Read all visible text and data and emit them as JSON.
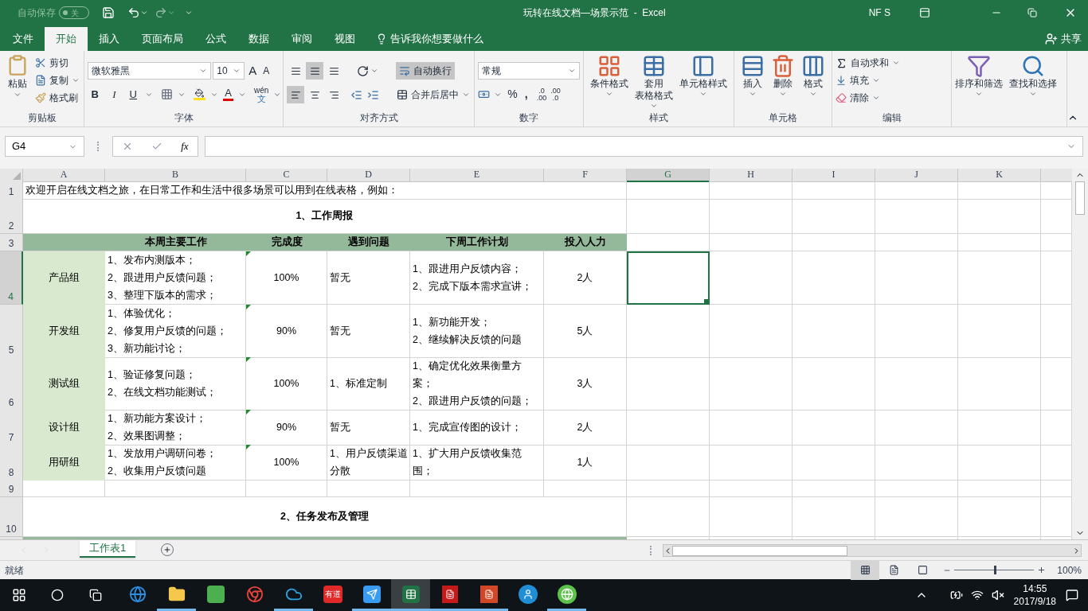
{
  "title_bar": {
    "autosave": {
      "label": "自动保存",
      "on": false,
      "state_label": "关"
    },
    "title": "玩转在线文档—场景示范  -  Excel",
    "user": "NF S"
  },
  "ribbon_tabs": [
    {
      "label": "文件",
      "selected": false
    },
    {
      "label": "开始",
      "selected": true
    },
    {
      "label": "插入",
      "selected": false
    },
    {
      "label": "页面布局",
      "selected": false
    },
    {
      "label": "公式",
      "selected": false
    },
    {
      "label": "数据",
      "selected": false
    },
    {
      "label": "审阅",
      "selected": false
    },
    {
      "label": "视图",
      "selected": false
    }
  ],
  "tell_me": "告诉我你想要做什么",
  "share": "共享",
  "clipboard": {
    "paste": "粘贴",
    "cut": "剪切",
    "copy": "复制",
    "format_painter": "格式刷",
    "label": "剪贴板"
  },
  "font": {
    "name": "微软雅黑",
    "size": "10",
    "grow": "A",
    "shrink": "A",
    "bold": "B",
    "italic": "I",
    "underline": "U",
    "color_letter": "A",
    "phonetic_top": "wén",
    "phonetic_bottom": "文",
    "label": "字体"
  },
  "alignment": {
    "vertical": [
      {
        "selected": false
      },
      {
        "selected": true
      },
      {
        "selected": false
      }
    ],
    "horizontal": [
      {
        "selected": true
      },
      {
        "selected": false
      },
      {
        "selected": false
      }
    ],
    "wrap": {
      "label": "自动换行",
      "on": true
    },
    "merge": "合并后居中",
    "label": "对齐方式"
  },
  "number": {
    "format": "常规",
    "percent": "%",
    "comma": ",",
    "increase_decimal": [
      ".0",
      ".00"
    ],
    "decrease_decimal": [
      ".00",
      ".0"
    ],
    "label": "数字"
  },
  "styles": {
    "conditional": [
      "条件格式"
    ],
    "table": [
      "套用",
      "表格格式"
    ],
    "cell": [
      "单元格样式"
    ],
    "label": "样式"
  },
  "cells": {
    "insert": "插入",
    "delete": "删除",
    "format": "格式",
    "label": "单元格"
  },
  "editing": {
    "autosum": "自动求和",
    "fill": "填充",
    "clear": "清除",
    "sort": "排序和筛选",
    "find": "查找和选择",
    "label": "编辑"
  },
  "formula_bar": {
    "name_box": "G4",
    "fx": "fx"
  },
  "columns": [
    {
      "label": "A",
      "selected": false
    },
    {
      "label": "B",
      "selected": false
    },
    {
      "label": "C",
      "selected": false
    },
    {
      "label": "D",
      "selected": false
    },
    {
      "label": "E",
      "selected": false
    },
    {
      "label": "F",
      "selected": false
    },
    {
      "label": "G",
      "selected": true
    },
    {
      "label": "H",
      "selected": false
    },
    {
      "label": "I",
      "selected": false
    },
    {
      "label": "J",
      "selected": false
    },
    {
      "label": "K",
      "selected": false
    }
  ],
  "sheet": {
    "intro": "欢迎开启在线文档之旅，在日常工作和生活中很多场景可以用到在线表格，例如：",
    "report_title": "1、工作周报",
    "headers": [
      "本周主要工作",
      "完成度",
      "遇到问题",
      "下周工作计划",
      "投入人力"
    ],
    "rows": [
      {
        "group": "产品组",
        "tasks": [
          "1、发布内测版本；",
          "2、跟进用户反馈问题；",
          "3、整理下版本的需求；"
        ],
        "completion": "100%",
        "flagged": true,
        "issues": [
          "暂无"
        ],
        "next": [
          "1、跟进用户反馈内容；",
          "2、完成下版本需求宣讲；"
        ],
        "staff": "2人"
      },
      {
        "group": "开发组",
        "tasks": [
          "1、体验优化；",
          "2、修复用户反馈的问题；",
          "3、新功能讨论；"
        ],
        "completion": "90%",
        "flagged": true,
        "issues": [
          "暂无"
        ],
        "next": [
          "1、新功能开发；",
          "2、继续解决反馈的问题"
        ],
        "staff": "5人"
      },
      {
        "group": "测试组",
        "tasks": [
          "1、验证修复问题；",
          "2、在线文档功能测试；"
        ],
        "completion": "100%",
        "flagged": true,
        "issues": [
          "1、标准定制"
        ],
        "next": [
          "1、确定优化效果衡量方",
          "案；",
          "2、跟进用户反馈的问题；"
        ],
        "staff": "3人"
      },
      {
        "group": "设计组",
        "tasks": [
          "1、新功能方案设计；",
          "2、效果图调整；"
        ],
        "completion": "90%",
        "flagged": true,
        "issues": [
          "暂无"
        ],
        "next": [
          "1、完成宣传图的设计；"
        ],
        "staff": "2人"
      },
      {
        "group": "用研组",
        "tasks": [
          "1、发放用户调研问卷；",
          "2、收集用户反馈问题"
        ],
        "completion": "100%",
        "flagged": true,
        "issues": [
          "1、用户反馈渠道",
          "分散"
        ],
        "next": [
          "1、扩大用户反馈收集范",
          "围；"
        ],
        "staff": "1人"
      }
    ],
    "section_2_title": "2、任务发布及管理"
  },
  "row_numbers": [
    {
      "label": "1",
      "selected": false
    },
    {
      "label": "2",
      "selected": false
    },
    {
      "label": "3",
      "selected": false
    },
    {
      "label": "4",
      "selected": true
    },
    {
      "label": "5",
      "selected": false
    },
    {
      "label": "6",
      "selected": false
    },
    {
      "label": "7",
      "selected": false
    },
    {
      "label": "8",
      "selected": false
    },
    {
      "label": "9",
      "selected": false
    },
    {
      "label": "10",
      "selected": false
    }
  ],
  "sheet_tabs": [
    {
      "label": "工作表1",
      "selected": true
    }
  ],
  "status_bar": {
    "status": "就绪",
    "views": [
      {
        "selected": true
      },
      {
        "selected": false
      },
      {
        "selected": false
      }
    ],
    "zoom": {
      "level": 0.5
    },
    "zoom_label": "100%"
  },
  "taskbar": {
    "apps": [
      {
        "kind": "edge",
        "running": false,
        "active": false
      },
      {
        "kind": "folder",
        "running": true,
        "active": false
      },
      {
        "kind": "evernote",
        "running": false,
        "active": false
      },
      {
        "kind": "chrome",
        "running": false,
        "active": false
      },
      {
        "kind": "cloud",
        "running": true,
        "active": false
      },
      {
        "kind": "youdao",
        "label": "有道",
        "running": false,
        "active": false
      },
      {
        "kind": "dingtalk",
        "running": true,
        "active": false
      },
      {
        "kind": "excel",
        "running": true,
        "active": true
      },
      {
        "kind": "pdf",
        "running": true,
        "active": false
      },
      {
        "kind": "powerpoint",
        "running": true,
        "active": false
      },
      {
        "kind": "contacts",
        "running": false,
        "active": false
      },
      {
        "kind": "browser360",
        "running": true,
        "active": false
      }
    ],
    "time": "14:55",
    "date": "2017/9/18"
  }
}
